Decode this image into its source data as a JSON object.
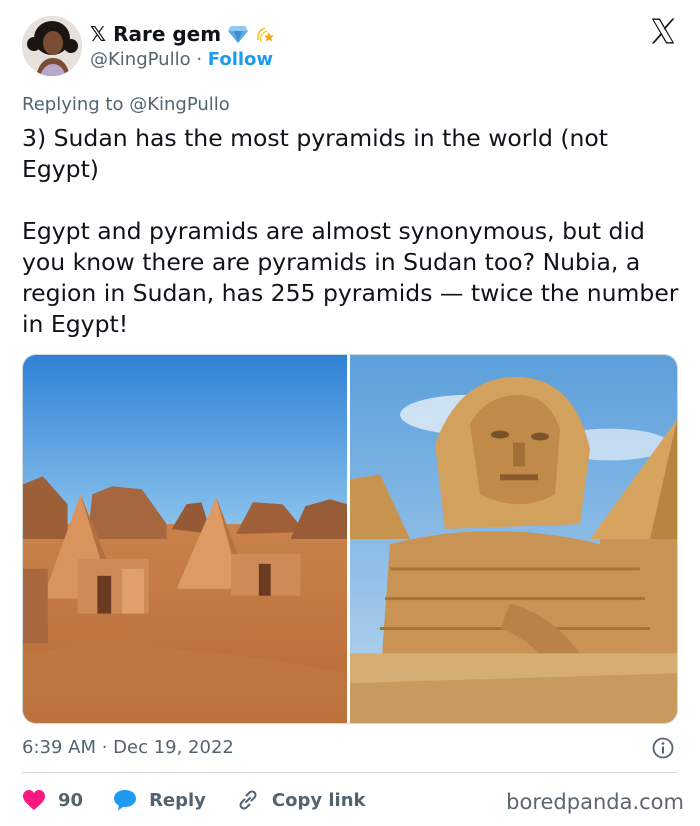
{
  "author": {
    "display_name": "𝕏 Rare gem",
    "verified_badge_icon": "diamond-icon",
    "extra_badge_icon": "dizzy-star-icon",
    "handle": "@KingPullo",
    "separator": " · ",
    "follow_label": "Follow"
  },
  "close_icon": "x-logo-icon",
  "replying_to": "Replying to @KingPullo",
  "tweet": {
    "line1": "3) Sudan has the most pyramids in the world (not Egypt)",
    "line2": "Egypt and pyramids are almost synonymous, but did you know there are pyramids in Sudan too? Nubia, a region in Sudan, has 255 pyramids — twice the number in Egypt!"
  },
  "media": [
    {
      "description": "photo-nubian-pyramids"
    },
    {
      "description": "photo-great-sphinx"
    }
  ],
  "timestamp": "6:39 AM · Dec 19, 2022",
  "actions": {
    "likes_count": "90",
    "reply_label": "Reply",
    "copy_link_label": "Copy link"
  },
  "watermark": "boredpanda.com",
  "colors": {
    "accent": "#1d9bf0",
    "like": "#f91880",
    "text": "#0f1419",
    "secondary": "#536471"
  }
}
